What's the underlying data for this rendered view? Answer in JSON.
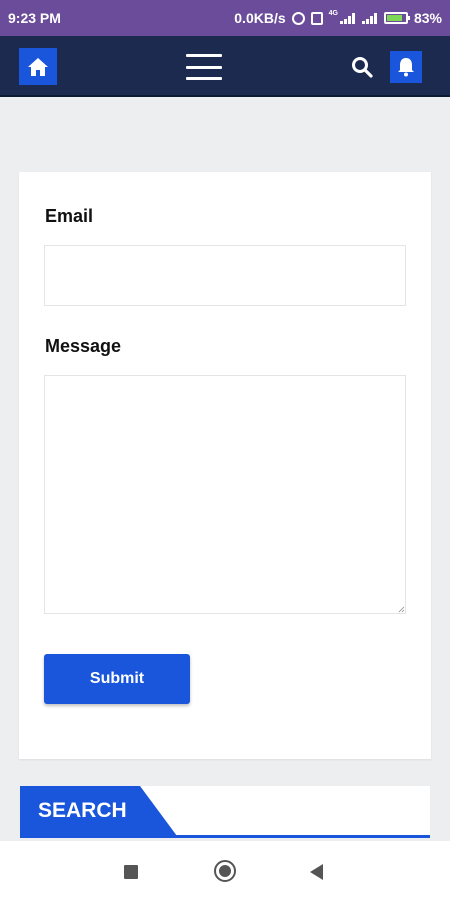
{
  "status_bar": {
    "time": "9:23 PM",
    "network_speed": "0.0KB/s",
    "network_type": "4G",
    "battery": "83%",
    "battery_level": 0.83,
    "icons": [
      "alarm-icon",
      "sim-icon",
      "signal-icon",
      "signal-icon",
      "battery-charging-icon"
    ]
  },
  "navbar": {
    "icons": [
      "home-icon",
      "hamburger-menu-icon",
      "search-icon",
      "bell-icon"
    ],
    "colors": {
      "background": "#1b2a4e",
      "accent": "#1a56db"
    }
  },
  "form": {
    "email_label": "Email",
    "email_value": "",
    "message_label": "Message",
    "message_value": "",
    "submit_label": "Submit"
  },
  "search_widget": {
    "title": "SEARCH"
  },
  "system_nav": {
    "icons": [
      "recent-apps-icon",
      "home-circle-icon",
      "back-icon"
    ]
  }
}
